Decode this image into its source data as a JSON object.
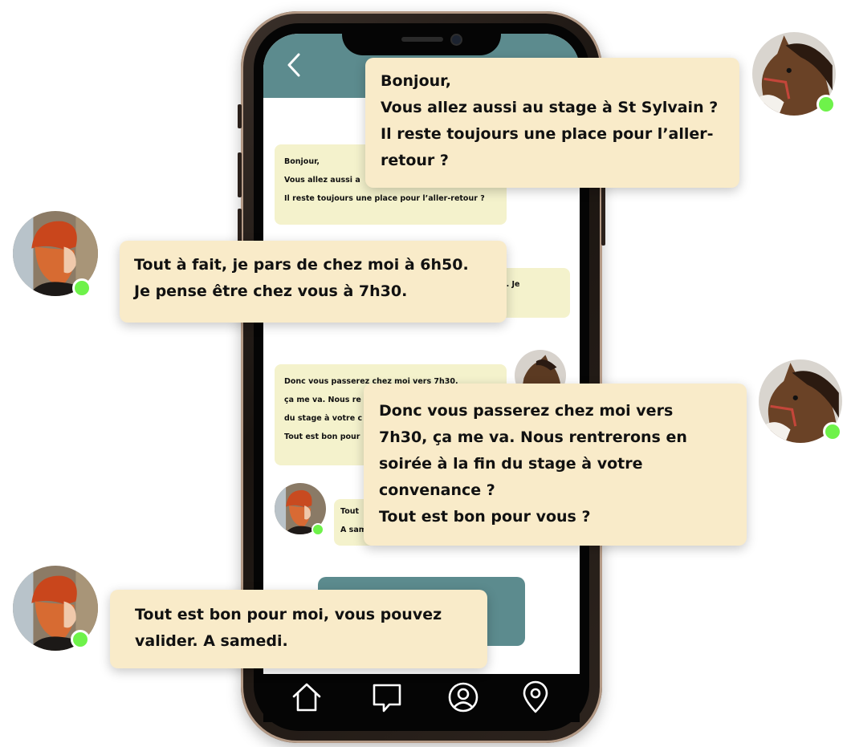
{
  "screen": {
    "messages": [
      {
        "lines": [
          "Bonjour,",
          "Vous allez aussi a",
          "Il reste toujours une place pour l’aller-retour ?"
        ]
      },
      {
        "lines": [
          "6h50. Je"
        ]
      },
      {
        "lines": [
          "Donc vous passerez chez moi  vers 7h30,",
          "ça me va. Nous re",
          "du stage à votre c",
          "Tout est bon pour"
        ]
      },
      {
        "lines": [
          "Tout",
          "A sam"
        ]
      }
    ]
  },
  "nav": {
    "icons": [
      "home-icon",
      "chat-icon",
      "profile-icon",
      "location-icon"
    ]
  },
  "bubbles": [
    {
      "sender": "horse",
      "lines": [
        "Bonjour,",
        "Vous allez aussi au stage à St Sylvain ?",
        "Il reste toujours une place pour l’aller-",
        "retour ?"
      ]
    },
    {
      "sender": "woman",
      "lines": [
        "Tout à fait,  je pars de chez moi à 6h50.",
        "Je pense être chez vous à 7h30."
      ]
    },
    {
      "sender": "horse",
      "lines": [
        "Donc vous passerez chez moi  vers",
        "7h30, ça me va. Nous rentrerons en",
        "soirée à la fin du stage à votre",
        "convenance ?",
        "Tout est bon pour vous ?"
      ]
    },
    {
      "sender": "woman",
      "lines": [
        "Tout est bon pour moi, vous pouvez",
        "valider. A samedi."
      ]
    }
  ],
  "colors": {
    "header_teal": "#5c8b8e",
    "bubble_cream": "#f9ebc9",
    "mini_bubble": "#f4f2cc",
    "online_green": "#6ef24a"
  }
}
